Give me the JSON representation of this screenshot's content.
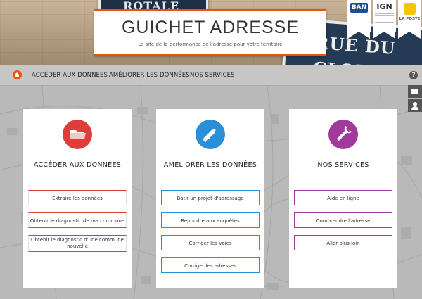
{
  "header": {
    "title": "GUICHET ADRESSE",
    "subtitle": "Le site de la performance de l'adresse pour votre territoire",
    "street_sign_1": "ROTALE",
    "street_sign_2_line1": "RUE DU",
    "street_sign_2_line2": "CLOITRE"
  },
  "partners": {
    "ban": "BAN",
    "ign": "IGN",
    "poste": "LA POSTE"
  },
  "nav": {
    "items": [
      "ACCÉDER AUX DONNÉES",
      "AMÉLIORER LES DONNÉES",
      "NOS SERVICES"
    ],
    "help": "?"
  },
  "colors": {
    "accent": "#e2560f",
    "red": "#e03c3c",
    "blue": "#2a8fd6",
    "purple": "#a23a9e"
  },
  "cards": [
    {
      "title": "ACCÉDER AUX DONNÉES",
      "icon": "folder-icon",
      "buttons": [
        "Extraire les données",
        "Obtenir le diagnostic de ma commune",
        "Obtenir le diagnostic d'une commune nouvelle"
      ]
    },
    {
      "title": "AMÉLIORER LES DONNÉES",
      "icon": "pencil-icon",
      "buttons": [
        "Bâtir un projet d'adressage",
        "Répondre aux enquêtes",
        "Corriger les voies",
        "Corriger les adresses"
      ]
    },
    {
      "title": "NOS SERVICES",
      "icon": "wrench-icon",
      "buttons": [
        "Aide en ligne",
        "Comprendre l'adresse",
        "Aller plus loin"
      ]
    }
  ]
}
